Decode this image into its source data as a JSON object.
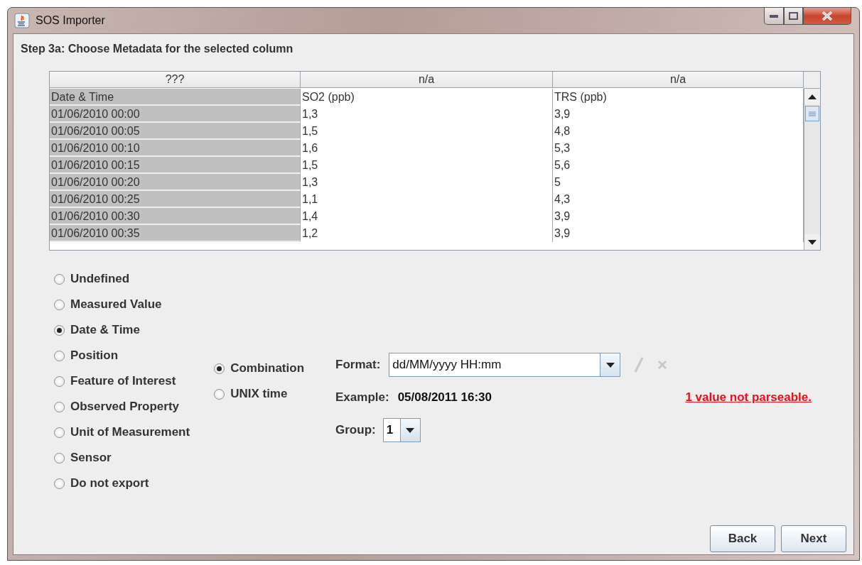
{
  "window": {
    "title": "SOS Importer"
  },
  "step_title": "Step 3a: Choose Metadata for the selected column",
  "table": {
    "columns": [
      {
        "header": "???",
        "selected": true
      },
      {
        "header": "n/a",
        "selected": false
      },
      {
        "header": "n/a",
        "selected": false
      }
    ],
    "rows": [
      [
        "Date & Time",
        "SO2 (ppb)",
        "TRS (ppb)"
      ],
      [
        "01/06/2010 00:00",
        "1,3",
        "3,9"
      ],
      [
        "01/06/2010 00:05",
        "1,5",
        "4,8"
      ],
      [
        "01/06/2010 00:10",
        "1,6",
        "5,3"
      ],
      [
        "01/06/2010 00:15",
        "1,5",
        "5,6"
      ],
      [
        "01/06/2010 00:20",
        "1,3",
        "5"
      ],
      [
        "01/06/2010 00:25",
        "1,1",
        "4,3"
      ],
      [
        "01/06/2010 00:30",
        "1,4",
        "3,9"
      ],
      [
        "01/06/2010 00:35",
        "1,2",
        "3,9"
      ]
    ]
  },
  "metadata_types": [
    {
      "label": "Undefined",
      "selected": false
    },
    {
      "label": "Measured Value",
      "selected": false
    },
    {
      "label": "Date & Time",
      "selected": true
    },
    {
      "label": "Position",
      "selected": false
    },
    {
      "label": "Feature of Interest",
      "selected": false
    },
    {
      "label": "Observed Property",
      "selected": false
    },
    {
      "label": "Unit of Measurement",
      "selected": false
    },
    {
      "label": "Sensor",
      "selected": false
    },
    {
      "label": "Do not export",
      "selected": false
    }
  ],
  "date_time_types": [
    {
      "label": "Combination",
      "selected": true
    },
    {
      "label": "UNIX time",
      "selected": false
    }
  ],
  "format": {
    "label": "Format:",
    "value": "dd/MM/yyyy HH:mm",
    "edit_disabled": true,
    "delete_disabled": true
  },
  "example": {
    "label": "Example:",
    "value": "05/08/2011 16:30"
  },
  "error_link": "1 value not parseable.",
  "group": {
    "label": "Group:",
    "value": "1"
  },
  "buttons": [
    "Back",
    "Next"
  ]
}
